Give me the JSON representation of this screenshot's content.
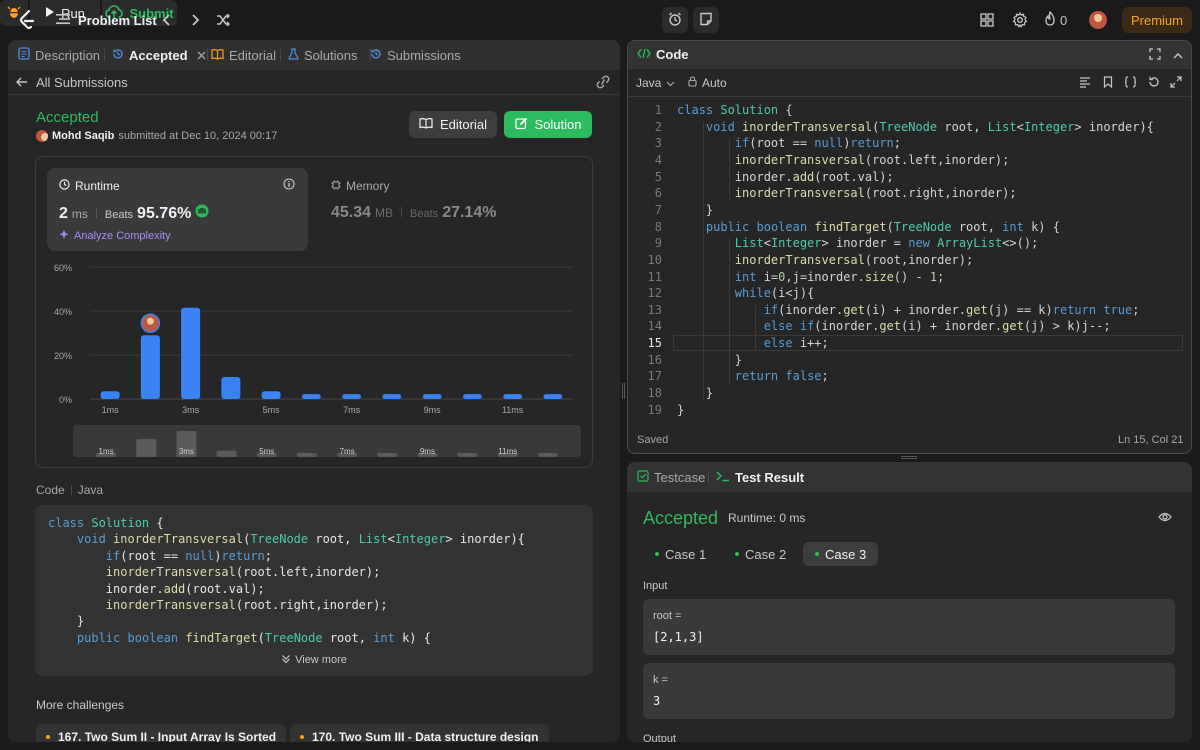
{
  "topbar": {
    "problem_list": "Problem List",
    "run": "Run",
    "submit": "Submit",
    "streak": "0",
    "premium": "Premium"
  },
  "left": {
    "tabs": [
      {
        "label": "Description"
      },
      {
        "label": "Accepted"
      },
      {
        "label": "Editorial"
      },
      {
        "label": "Solutions"
      },
      {
        "label": "Submissions"
      }
    ],
    "all_submissions": "All Submissions",
    "status": "Accepted",
    "author": "Mohd Saqib",
    "submitted_at": "submitted at Dec 10, 2024 00:17",
    "editorial_btn": "Editorial",
    "solution_btn": "Solution",
    "runtime": {
      "label": "Runtime",
      "value": "2",
      "unit": "ms",
      "beats_label": "Beats",
      "beats": "95.76%",
      "analyze": "Analyze Complexity"
    },
    "memory": {
      "label": "Memory",
      "value": "45.34",
      "unit": "MB",
      "beats_label": "Beats",
      "beats": "27.14%"
    },
    "code_header": "Code",
    "code_lang": "Java",
    "view_more": "View more",
    "more_challenges": "More challenges",
    "challenges": [
      "167. Two Sum II - Input Array Is Sorted",
      "170. Two Sum III - Data structure design"
    ]
  },
  "chart_data": {
    "type": "bar",
    "categories": [
      "1ms",
      "2ms",
      "3ms",
      "4ms",
      "5ms",
      "6ms",
      "7ms",
      "8ms",
      "9ms",
      "10ms",
      "11ms",
      "12ms"
    ],
    "tick_labels": [
      "1ms",
      "3ms",
      "5ms",
      "7ms",
      "9ms",
      "11ms"
    ],
    "values": [
      3.5,
      29,
      41.5,
      10,
      3.5,
      2.2,
      2.2,
      2.2,
      2.2,
      2.2,
      2.2,
      2.2
    ],
    "ylim": [
      0,
      60
    ],
    "yticks": [
      "0%",
      "20%",
      "40%",
      "60%"
    ],
    "highlight_index": 1,
    "grid": true,
    "bar_color": "#3b82f6"
  },
  "editor": {
    "title": "Code",
    "language": "Java",
    "auto": "Auto",
    "saved": "Saved",
    "position": "Ln 15, Col 21",
    "current_line": 15,
    "lines": [
      "class Solution {",
      "    void inorderTransversal(TreeNode root, List<Integer> inorder){",
      "        if(root == null)return;",
      "        inorderTransversal(root.left,inorder);",
      "        inorder.add(root.val);",
      "        inorderTransversal(root.right,inorder);",
      "    }",
      "    public boolean findTarget(TreeNode root, int k) {",
      "        List<Integer> inorder = new ArrayList<>();",
      "        inorderTransversal(root,inorder);",
      "        int i=0,j=inorder.size() - 1;",
      "        while(i<j){",
      "            if(inorder.get(i) + inorder.get(j) == k)return true;",
      "            else if(inorder.get(i) + inorder.get(j) > k)j--;",
      "            else i++;",
      "        }",
      "        return false;",
      "    }",
      "}"
    ]
  },
  "result": {
    "tab_testcase": "Testcase",
    "tab_result": "Test Result",
    "status": "Accepted",
    "runtime": "Runtime: 0 ms",
    "cases": [
      "Case 1",
      "Case 2",
      "Case 3"
    ],
    "input_label": "Input",
    "inputs": [
      {
        "name": "root =",
        "value": "[2,1,3]"
      },
      {
        "name": "k =",
        "value": "3"
      }
    ],
    "output_label": "Output"
  }
}
